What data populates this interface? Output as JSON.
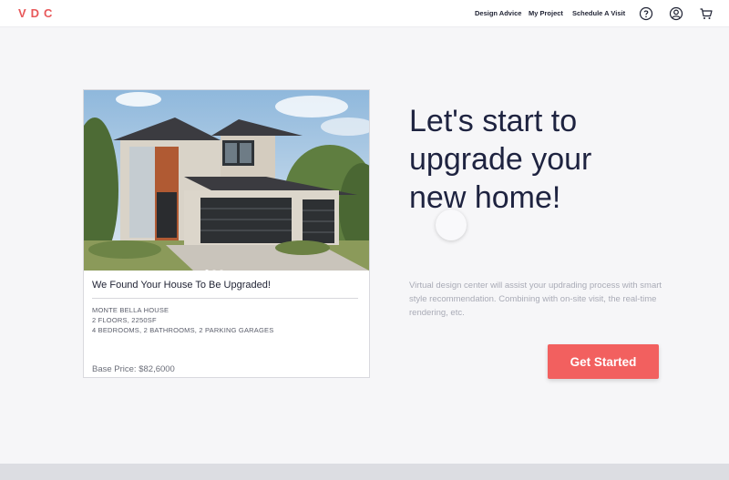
{
  "header": {
    "logo": "VDC",
    "nav": [
      "Design Advice",
      "My Project",
      "Schedule A Visit"
    ],
    "icons": [
      "help-icon",
      "account-icon",
      "cart-icon"
    ]
  },
  "card": {
    "image_alt": "modern two-storey house with garage",
    "carousel": {
      "slides": 3,
      "active": 1
    },
    "title": "We Found Your House To Be Upgraded!",
    "name": "MONTE BELLA HOUSE",
    "specs_1": "2 FLOORS, 2250SF",
    "specs_2": "4 BEDROOMS, 2 BATHROOMS, 2 PARKING GARAGES",
    "price": "Base Price: $82,6000"
  },
  "hero": {
    "headline_1": "Let's start to",
    "headline_2": "upgrade your",
    "headline_3": "new home!",
    "description": "Virtual design center will assist your updrading process with smart style recommendation. Combining with on-site visit, the real-time rendering, etc.",
    "cta_label": "Get Started"
  },
  "colors": {
    "brand": "#e8585a",
    "cta": "#f2605f",
    "headline": "#1e2340",
    "background": "#f6f6f8"
  }
}
